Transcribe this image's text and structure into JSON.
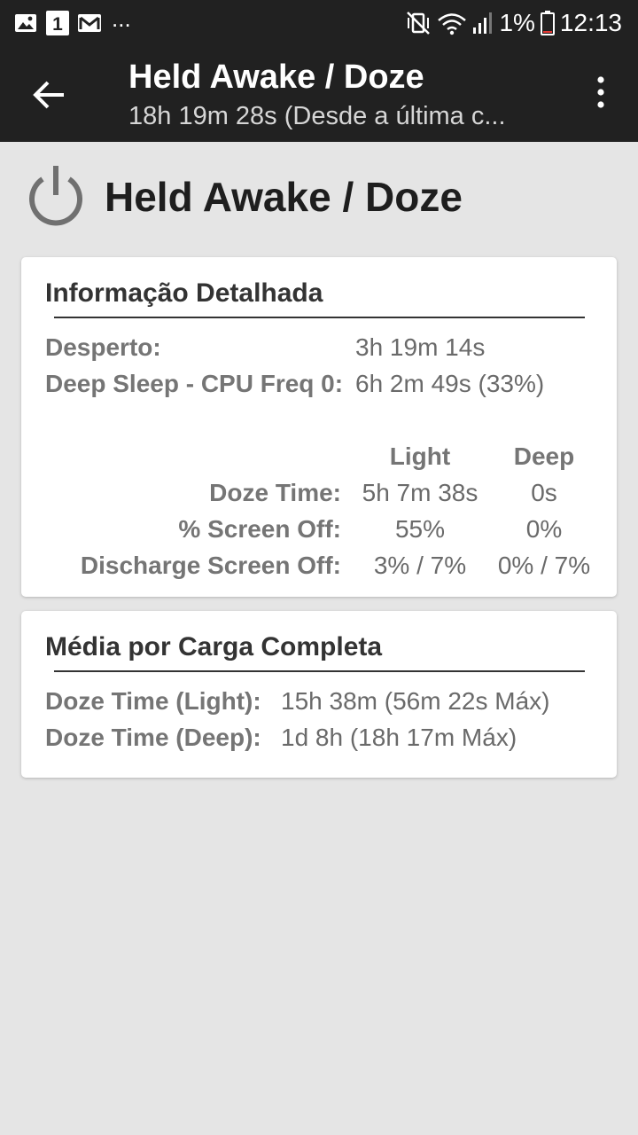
{
  "status_bar": {
    "notification_count": "1",
    "overflow": "...",
    "battery": "1%",
    "time": "12:13"
  },
  "app_bar": {
    "title": "Held Awake / Doze",
    "subtitle": "18h 19m 28s (Desde a última c..."
  },
  "headline": {
    "title": "Held Awake / Doze",
    "icon": "power-icon"
  },
  "detail_card": {
    "title": "Informação Detalhada",
    "awake_label": "Desperto:",
    "awake_value": "3h 19m 14s",
    "deep_sleep_label": "Deep Sleep - CPU Freq 0:",
    "deep_sleep_value": "6h 2m 49s (33%)",
    "columns": {
      "light": "Light",
      "deep": "Deep"
    },
    "rows": [
      {
        "label": "Doze Time:",
        "light": "5h 7m 38s",
        "deep": "0s"
      },
      {
        "label": "% Screen Off:",
        "light": "55%",
        "deep": "0%"
      },
      {
        "label": "Discharge Screen Off:",
        "light": "3% / 7%",
        "deep": "0% / 7%"
      }
    ]
  },
  "average_card": {
    "title": "Média por Carga Completa",
    "rows": [
      {
        "label": "Doze Time (Light):",
        "value": "15h 38m (56m 22s Máx)"
      },
      {
        "label": "Doze Time (Deep):",
        "value": "1d 8h (18h 17m Máx)"
      }
    ]
  },
  "colors": {
    "app_bar": "#212121",
    "background": "#e5e5e5",
    "card": "#ffffff",
    "label_gray": "#757575"
  }
}
